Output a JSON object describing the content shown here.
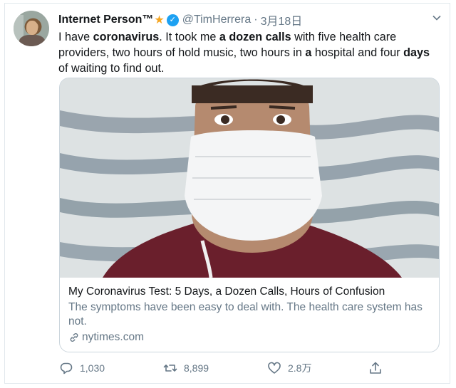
{
  "tweet": {
    "display_name": "Internet Person™",
    "handle": "@TimHerrera",
    "separator": "·",
    "date": "3月18日",
    "text_parts": [
      "I have ",
      "coronavirus",
      ". It took me ",
      "a dozen calls",
      " with five health care providers, two hours of hold music, two hours in ",
      "a",
      " hospital and four ",
      "days",
      " of waiting to find out."
    ]
  },
  "card": {
    "title": "My Coronavirus Test: 5 Days, a Dozen Calls, Hours of Confusion",
    "description": "The symptoms have been easy to deal with. The health care system has not.",
    "domain": "nytimes.com"
  },
  "actions": {
    "reply_count": "1,030",
    "retweet_count": "8,899",
    "like_count": "2.8万"
  },
  "colors": {
    "accent": "#1da1f2",
    "star": "#f5a623",
    "muted": "#657786"
  },
  "icons": [
    "star-icon",
    "verified-icon",
    "chevron-down-icon",
    "link-icon",
    "reply-icon",
    "retweet-icon",
    "like-icon",
    "share-icon"
  ]
}
